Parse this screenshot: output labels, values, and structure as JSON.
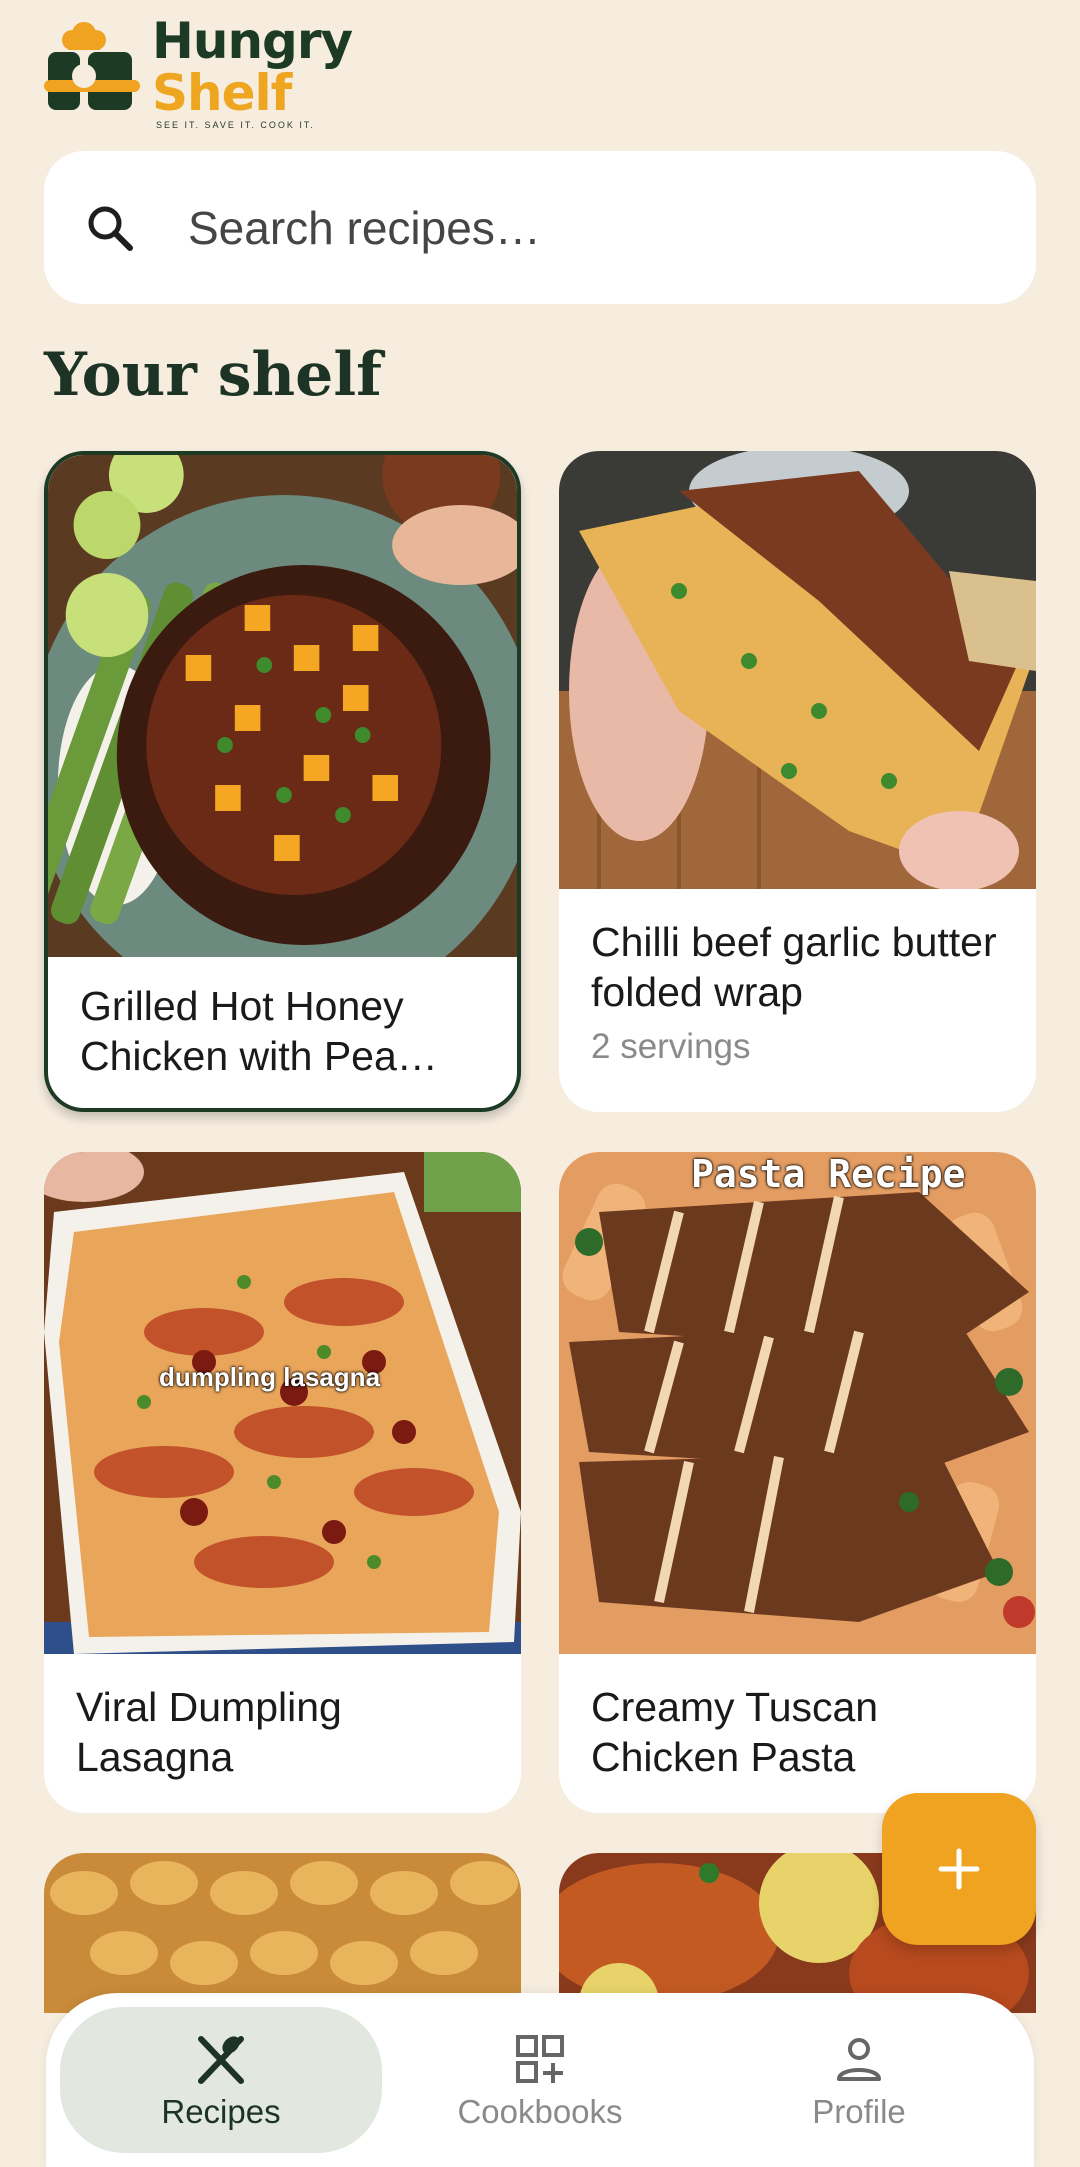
{
  "brand": {
    "line1": "Hungry",
    "line2": "Shelf",
    "tagline": "SEE IT. SAVE IT. COOK IT."
  },
  "search": {
    "placeholder": "Search recipes…"
  },
  "section_title": "Your shelf",
  "recipes": [
    {
      "title": "Grilled Hot Honey Chicken with Pea…",
      "servings": "",
      "overlay": ""
    },
    {
      "title": "Chilli beef garlic butter folded wrap",
      "servings": "2 servings",
      "overlay": ""
    },
    {
      "title": "Viral Dumpling Lasagna",
      "servings": "",
      "overlay": "dumpling lasagna"
    },
    {
      "title": "Creamy Tuscan Chicken Pasta",
      "servings": "",
      "overlay": "Pasta Recipe"
    }
  ],
  "nav": [
    {
      "label": "Recipes",
      "icon": "fork-knife-icon",
      "active": true
    },
    {
      "label": "Cookbooks",
      "icon": "grid-plus-icon",
      "active": false
    },
    {
      "label": "Profile",
      "icon": "person-icon",
      "active": false
    }
  ],
  "fab_icon": "plus-icon",
  "colors": {
    "accent": "#efa320",
    "brand_green": "#1d3a24",
    "background": "#f6eddf"
  }
}
